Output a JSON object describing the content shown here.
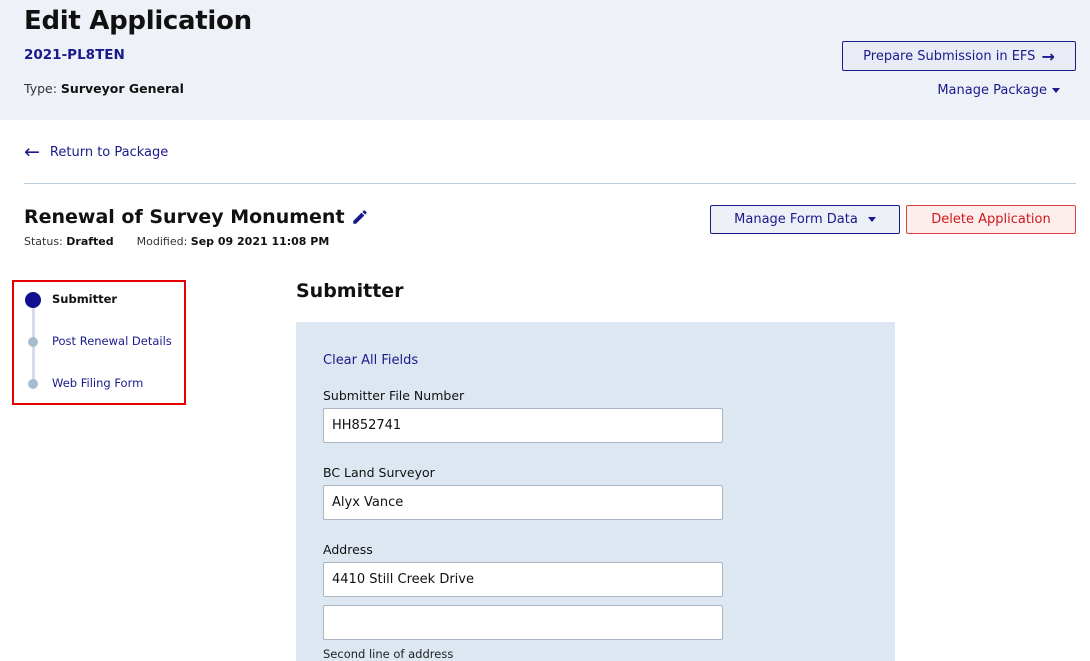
{
  "header": {
    "title": "Edit Application",
    "application_id": "2021-PL8TEN",
    "type_label": "Type:",
    "type_value": "Surveyor General",
    "prepare_button": "Prepare Submission in EFS",
    "prepare_icon": "arrow-right-icon",
    "manage_package": "Manage Package"
  },
  "nav": {
    "return_link": "Return to Package",
    "return_icon": "arrow-left-icon"
  },
  "form": {
    "title": "Renewal of Survey Monument",
    "edit_icon": "pencil-icon",
    "status_label": "Status:",
    "status_value": "Drafted",
    "modified_label": "Modified:",
    "modified_value": "Sep 09 2021 11:08 PM",
    "manage_form_data": "Manage Form Data",
    "delete_application": "Delete Application"
  },
  "stepper": {
    "steps": [
      {
        "label": "Submitter",
        "state": "active"
      },
      {
        "label": "Post Renewal Details",
        "state": "pending"
      },
      {
        "label": "Web Filing Form",
        "state": "pending"
      }
    ]
  },
  "section": {
    "title": "Submitter",
    "clear_all": "Clear All Fields",
    "fields": [
      {
        "label": "Submitter File Number",
        "value": "HH852741",
        "placeholder": ""
      },
      {
        "label": "BC Land Surveyor",
        "value": "Alyx Vance",
        "placeholder": ""
      },
      {
        "label": "Address",
        "value": "4410 Still Creek Drive",
        "placeholder": ""
      },
      {
        "label": "",
        "value": "",
        "placeholder": ""
      }
    ],
    "address_line2_help": "Second line of address"
  },
  "colors": {
    "primary": "#1a1a8c",
    "danger": "#d01818",
    "header_bg": "#eef2f8",
    "panel_bg": "#dde7f1",
    "highlight_box": "#e80000"
  }
}
